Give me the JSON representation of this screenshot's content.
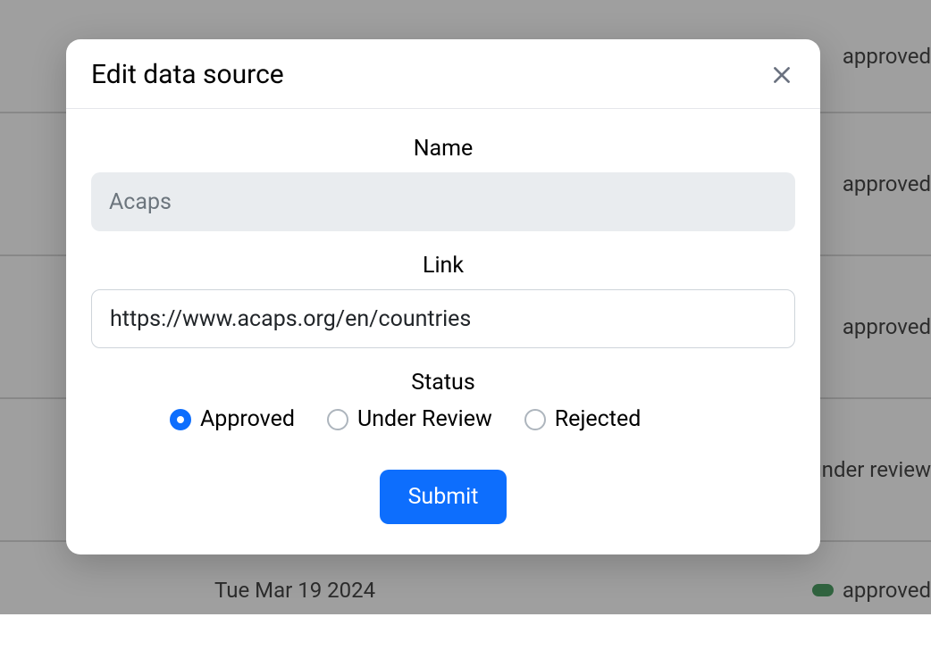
{
  "background": {
    "rows": [
      {
        "status": "approved"
      },
      {
        "status": "approved"
      },
      {
        "status": "approved"
      },
      {
        "status": "under review"
      }
    ],
    "bottom": {
      "date": "Tue Mar 19 2024",
      "status": "approved"
    }
  },
  "modal": {
    "title": "Edit data source",
    "fields": {
      "name": {
        "label": "Name",
        "value": "Acaps"
      },
      "link": {
        "label": "Link",
        "value": "https://www.acaps.org/en/countries"
      },
      "status": {
        "label": "Status",
        "options": [
          {
            "label": "Approved",
            "selected": true
          },
          {
            "label": "Under Review",
            "selected": false
          },
          {
            "label": "Rejected",
            "selected": false
          }
        ]
      }
    },
    "submit_label": "Submit"
  }
}
